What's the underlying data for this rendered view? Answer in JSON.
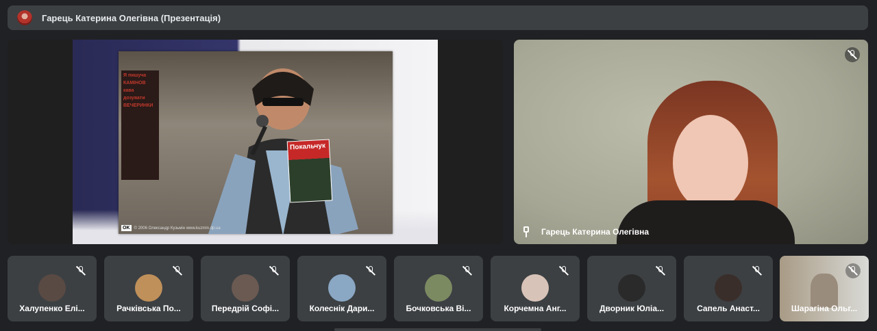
{
  "topbar": {
    "title": "Гарець Катерина Олегівна (Презентація)"
  },
  "presentation": {
    "photo_poster_lines": [
      "Я пишуча",
      "КАМІНОВ",
      "кава",
      "дозувати",
      "ВЕЧЕРИНКИ"
    ],
    "book_title": "Покальчук",
    "credit_logo": "OK",
    "credit_text": "© 2006 Олександр Кузьмін www.kuzmin.dp.ua"
  },
  "speaker": {
    "name": "Гарець Катерина Олегівна",
    "icons": [
      "mic-off-icon",
      "pin-icon"
    ]
  },
  "participants": [
    {
      "name": "Халупенко Елі...",
      "avatar_color": "#5a4a44"
    },
    {
      "name": "Рачківська По...",
      "avatar_color": "#c0905a"
    },
    {
      "name": "Передрій Софі...",
      "avatar_color": "#6b5a52"
    },
    {
      "name": "Колеснік Дари...",
      "avatar_color": "#8aa7c4"
    },
    {
      "name": "Бочковська Ві...",
      "avatar_color": "#7c8a62"
    },
    {
      "name": "Корчемна Анг...",
      "avatar_color": "#d8c3b8"
    },
    {
      "name": "Дворник Юліа...",
      "avatar_color": "#2a2a2a"
    },
    {
      "name": "Сапель Анаст...",
      "avatar_color": "#3a2e2a"
    },
    {
      "name": "Шарагіна Ольг...",
      "avatar_color": "#9a8c7c"
    }
  ]
}
